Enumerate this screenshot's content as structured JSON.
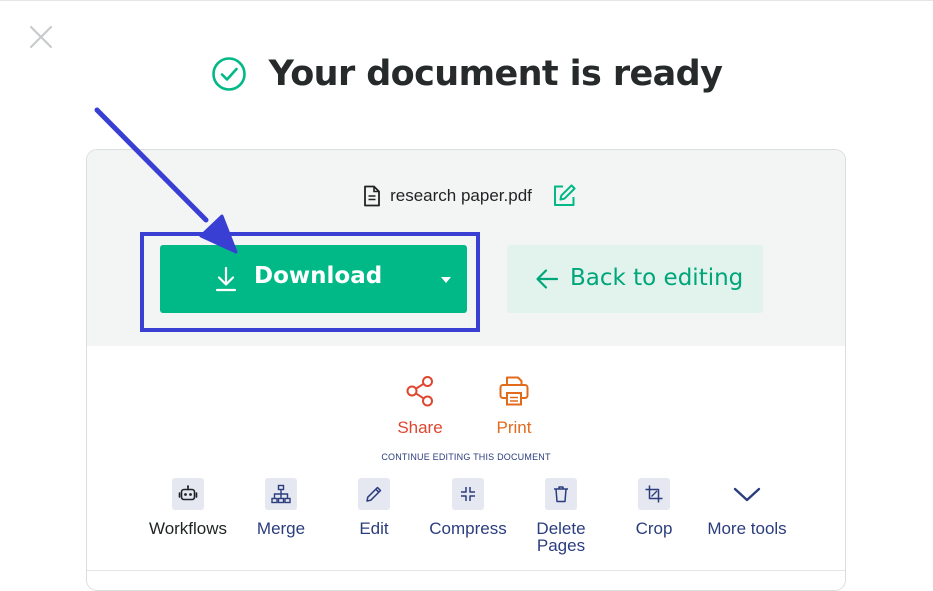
{
  "header": {
    "title": "Your document is ready"
  },
  "file": {
    "name": "research paper.pdf"
  },
  "actions": {
    "download_label": "Download",
    "back_label": "Back to editing"
  },
  "quick_actions": [
    {
      "label": "Share",
      "icon": "share-icon",
      "color": "#e0462f"
    },
    {
      "label": "Print",
      "icon": "printer-icon",
      "color": "#e26a1c"
    }
  ],
  "continue_label": "CONTINUE EDITING THIS DOCUMENT",
  "tools": [
    {
      "label": "Workflows",
      "icon": "robot-icon"
    },
    {
      "label": "Merge",
      "icon": "merge-icon"
    },
    {
      "label": "Edit",
      "icon": "pencil-icon"
    },
    {
      "label": "Compress",
      "icon": "compress-icon"
    },
    {
      "label": "Delete Pages",
      "line1": "Delete",
      "line2": "Pages",
      "icon": "trash-icon"
    },
    {
      "label": "Crop",
      "icon": "crop-icon"
    },
    {
      "label": "More tools",
      "icon": "chevron-down-icon"
    }
  ],
  "colors": {
    "accent": "#00b986",
    "accent_light": "#e1f3ec",
    "highlight": "#3a3fd4",
    "tool_text": "#2b3d7d"
  }
}
